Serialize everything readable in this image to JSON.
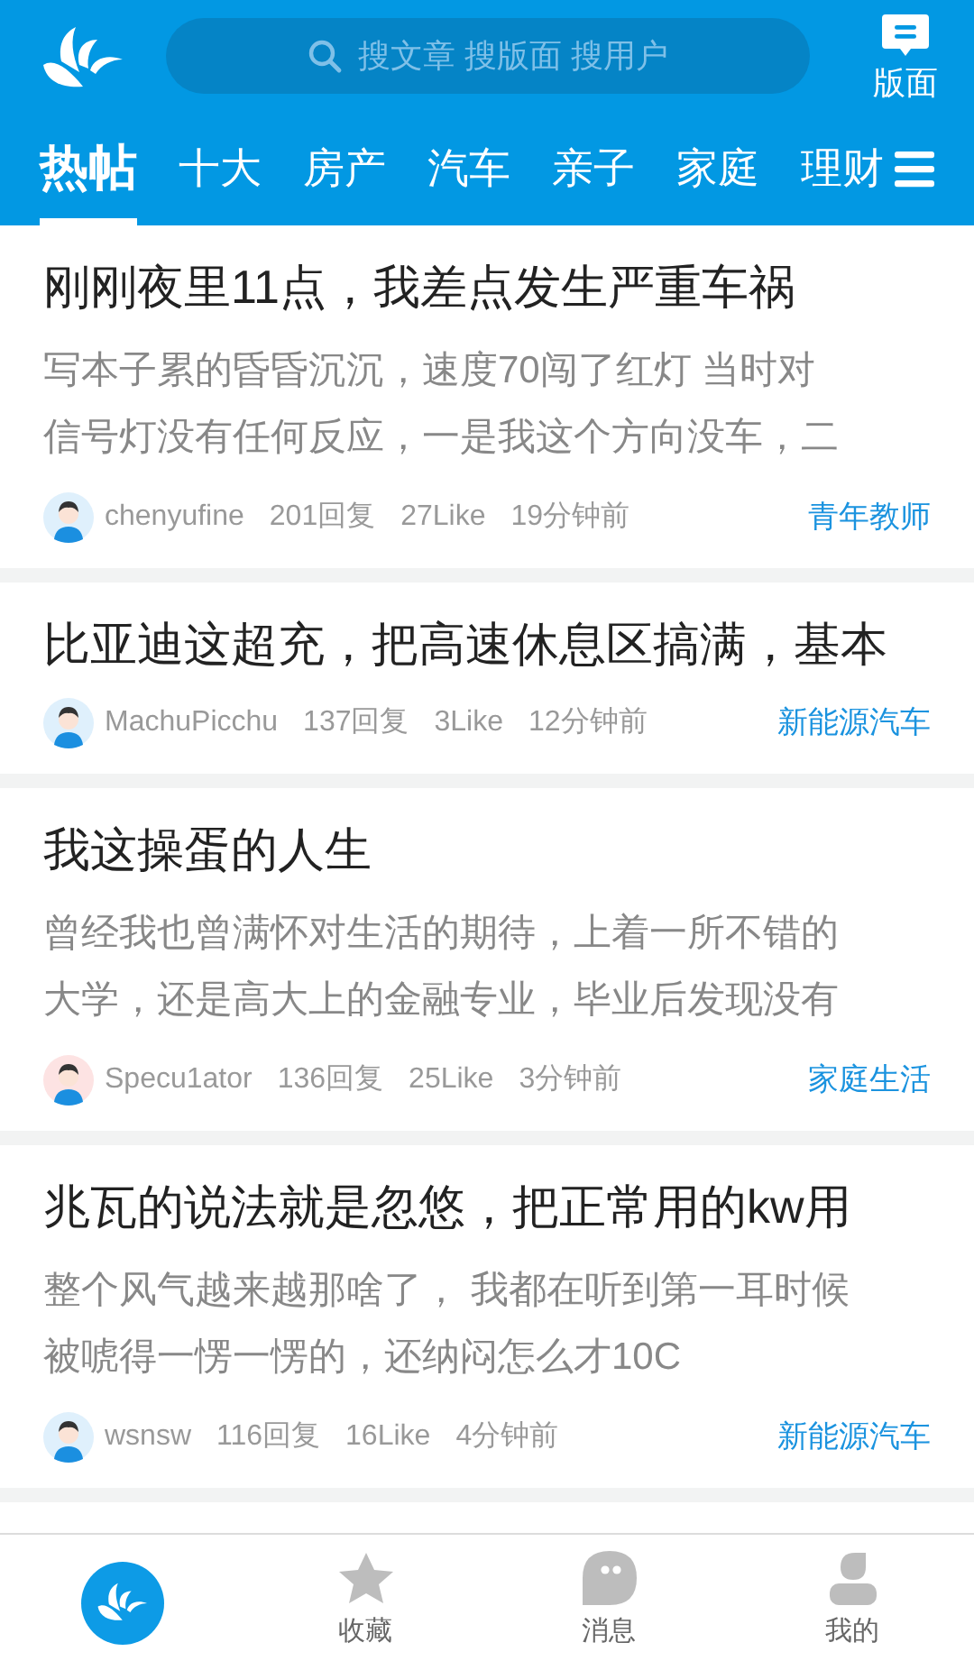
{
  "header": {
    "search": {
      "placeholder": "搜文章 搜版面 搜用户"
    },
    "boards_button": "版面"
  },
  "tabs": [
    {
      "label": "热帖",
      "selected": true
    },
    {
      "label": "十大",
      "selected": false
    },
    {
      "label": "房产",
      "selected": false
    },
    {
      "label": "汽车",
      "selected": false
    },
    {
      "label": "亲子",
      "selected": false
    },
    {
      "label": "家庭",
      "selected": false
    },
    {
      "label": "理财",
      "selected": false
    }
  ],
  "posts": [
    {
      "title": "刚刚夜里11点，我差点发生严重车祸",
      "excerpt": [
        "写本子累的昏昏沉沉，速度70闯了红灯 当时对",
        "信号灯没有任何反应，一是我这个方向没车，二"
      ],
      "author": "chenyufine",
      "color": "#dff0fc",
      "replies": "201回复",
      "likes": "27Like",
      "time": "19分钟前",
      "board": "青年教师"
    },
    {
      "title": "比亚迪这超充，把高速休息区搞满，基本",
      "author": "MachuPicchu",
      "color": "#dff0fc",
      "replies": "137回复",
      "likes": "3Like",
      "time": "12分钟前",
      "board": "新能源汽车"
    },
    {
      "title": "我这操蛋的人生",
      "excerpt": [
        "曾经我也曾满怀对生活的期待，上着一所不错的",
        "大学，还是高大上的金融专业，毕业后发现没有"
      ],
      "author": "Specu1ator",
      "color": "#fde3e3",
      "replies": "136回复",
      "likes": "25Like",
      "time": "3分钟前",
      "board": "家庭生活"
    },
    {
      "title": "兆瓦的说法就是忽悠，把正常用的kw用",
      "excerpt": [
        "整个风气越来越那啥了， 我都在听到第一耳时候",
        "被唬得一愣一愣的，还纳闷怎么才10C"
      ],
      "author": "wsnsw",
      "color": "#dff0fc",
      "replies": "116回复",
      "likes": "16Like",
      "time": "4分钟前",
      "board": "新能源汽车"
    }
  ],
  "bottom_nav": [
    {
      "kind": "home",
      "selected": true
    },
    {
      "kind": "star",
      "label": "收藏",
      "selected": false
    },
    {
      "kind": "chat",
      "label": "消息",
      "selected": false
    },
    {
      "kind": "person",
      "label": "我的",
      "selected": false
    }
  ]
}
